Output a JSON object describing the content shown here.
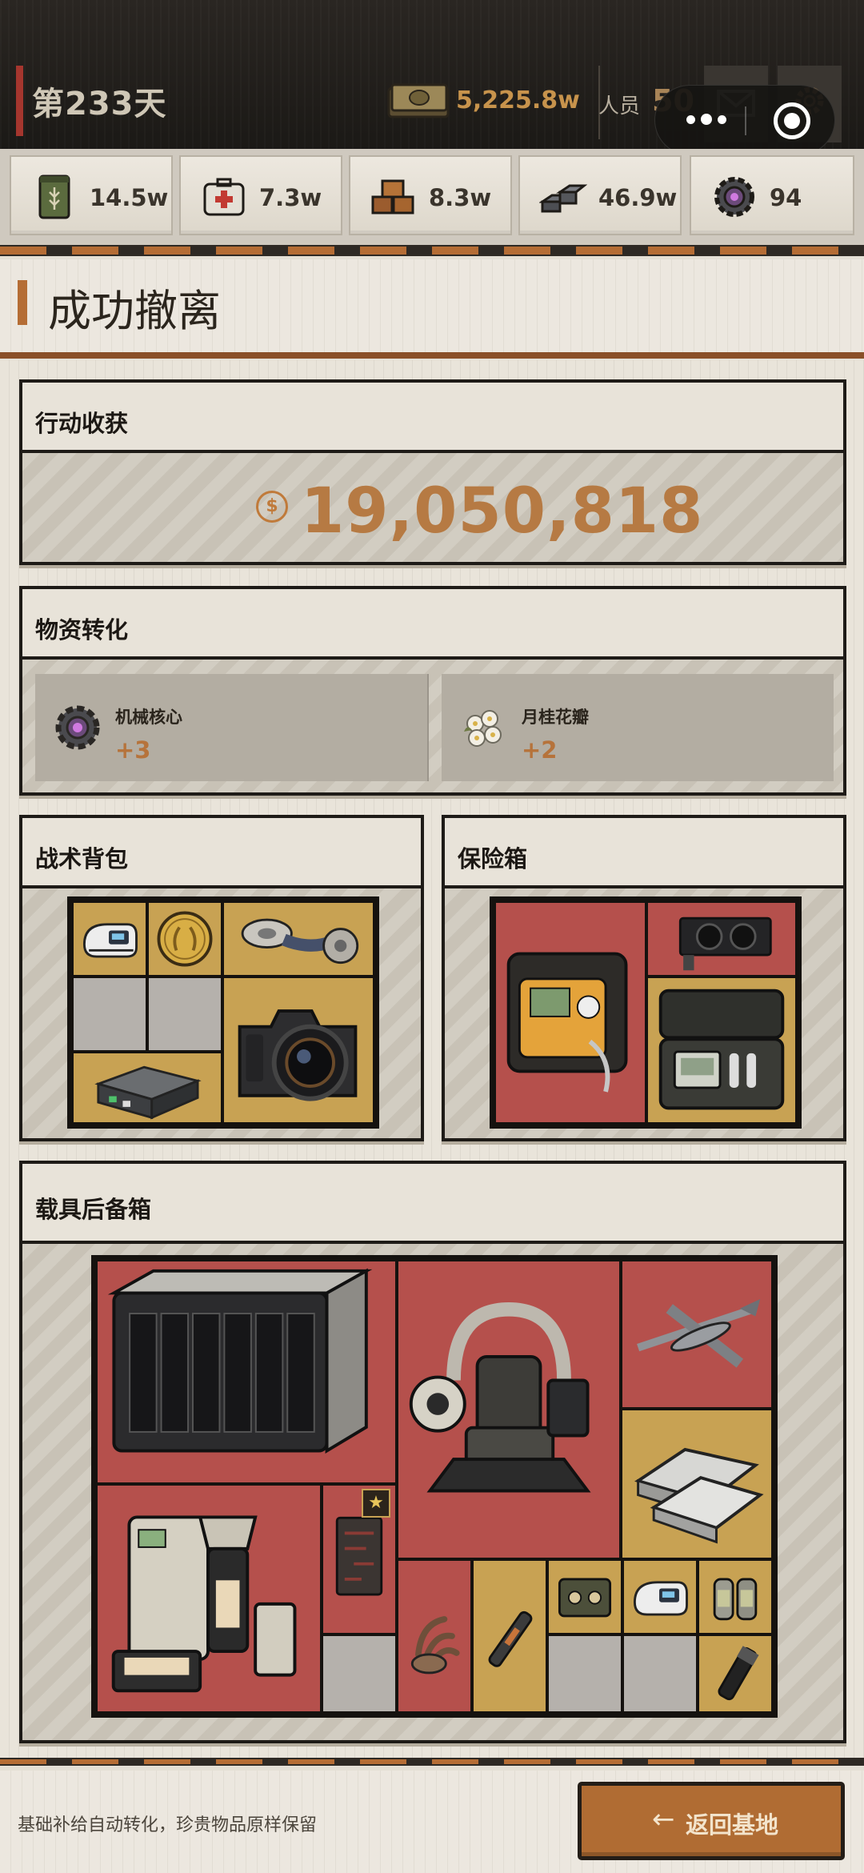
{
  "header": {
    "day": "第233天",
    "money": "5,225.8w",
    "staff_label": "人员",
    "staff_value": "50",
    "icons": [
      "money-stack-icon",
      "mail-icon",
      "gear-icon"
    ]
  },
  "capsule": {
    "icons": [
      "more-dots-icon",
      "close-target-icon"
    ]
  },
  "resources": [
    {
      "icon": "ration-can-icon",
      "value": "14.5w"
    },
    {
      "icon": "medkit-icon",
      "value": "7.3w"
    },
    {
      "icon": "wood-boxes-icon",
      "value": "8.3w"
    },
    {
      "icon": "metal-ingots-icon",
      "value": "46.9w"
    },
    {
      "icon": "mech-core-icon",
      "value": "94"
    }
  ],
  "page_title": "成功撤离",
  "earnings": {
    "title": "行动收获",
    "currency_symbol": "$",
    "value": "19,050,818"
  },
  "conversion": {
    "title": "物资转化",
    "items": [
      {
        "name": "机械核心",
        "amount": "+3",
        "icon": "mech-core-icon"
      },
      {
        "name": "月桂花瓣",
        "amount": "+2",
        "icon": "laurel-flower-icon"
      }
    ]
  },
  "backpack": {
    "title": "战术背包",
    "items": [
      "pulse-oximeter-icon",
      "gold-laurel-coin-icon",
      "bandage-roll-icon",
      "router-box-icon",
      "dslr-camera-icon"
    ]
  },
  "safe": {
    "title": "保险箱",
    "items": [
      "defibrillator-case-icon",
      "graphics-card-icon",
      "device-case-icon"
    ]
  },
  "trunk": {
    "title": "载具后备箱",
    "items": [
      "nas-server-icon",
      "mech-chair-icon",
      "drone-icon",
      "metal-plates-icon",
      "coffee-machine-icon",
      "circuit-card-icon",
      "claw-icon",
      "injector-icon",
      "cassette-icon",
      "pulse-oximeter-icon",
      "canisters-icon",
      "flashlight-icon"
    ]
  },
  "footer": {
    "note": "基础补给自动转化，珍贵物品原样保留",
    "back_arrow": "←",
    "back_label": "返回基地"
  },
  "colors": {
    "accent": "#b56d35",
    "gold_cell": "#c8a253",
    "red_cell": "#b5504c",
    "gray_cell": "#b5b1ac",
    "value_orange": "#b67a43",
    "day_accent": "#a5362e"
  }
}
